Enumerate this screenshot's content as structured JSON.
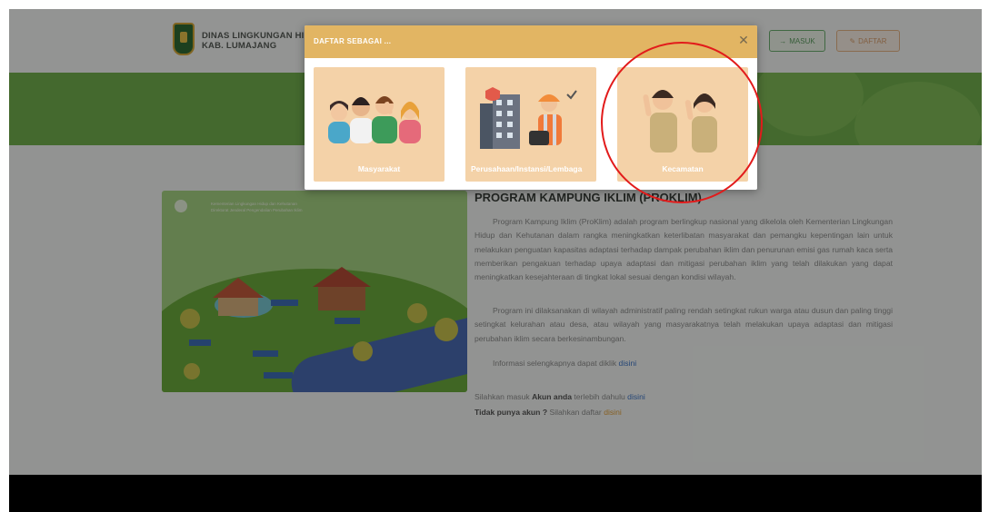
{
  "header": {
    "brand_line1": "DINAS LINGKUNGAN HI",
    "brand_line2": "KAB. LUMAJANG",
    "login_label": "MASUK",
    "register_label": "DAFTAR"
  },
  "icons": {
    "login_icon": "sign-in-icon",
    "register_icon": "edit-icon",
    "close_icon": "close-icon"
  },
  "illustration": {
    "title_line1": "Kementerian Lingkungan Hidup dan Kehutanan",
    "title_line2": "Direktorat Jenderal Pengendalian Perubahan Iklim"
  },
  "article": {
    "title": "PROGRAM KAMPUNG IKLIM (PROKLIM)",
    "paragraph1": "Program Kampung Iklim (ProKlim) adalah program berlingkup nasional yang dikelola oleh Kementerian Lingkungan Hidup dan Kehutanan dalam rangka meningkatkan keterlibatan masyarakat dan pemangku kepentingan lain untuk melakukan penguatan kapasitas adaptasi terhadap dampak perubahan iklim dan penurunan emisi gas rumah kaca serta memberikan pengakuan terhadap upaya adaptasi dan mitigasi perubahan iklim yang telah dilakukan yang dapat meningkatkan kesejahteraan di tingkat lokal sesuai dengan kondisi wilayah.",
    "paragraph2": "Program ini dilaksanakan di wilayah administratif paling rendah setingkat rukun warga atau dusun dan paling tinggi setingkat kelurahan atau desa, atau wilayah yang masyarakatnya telah melakukan upaya adaptasi dan mitigasi perubahan iklim secara berkesinambungan.",
    "info_text": "Informasi selengkapnya dapat diklik",
    "info_link": "disini",
    "login_prefix": "Silahkan masuk",
    "login_bold": "Akun anda",
    "login_middle": "terlebih dahulu",
    "login_link": "disini",
    "register_bold": "Tidak punya akun ?",
    "register_middle": "Silahkan daftar",
    "register_link": "disini"
  },
  "modal": {
    "title": "DAFTAR SEBAGAI ...",
    "options": [
      {
        "label": "Masyarakat"
      },
      {
        "label": "Perusahaan/Instansi/Lembaga"
      },
      {
        "label": "Kecamatan"
      }
    ]
  },
  "colors": {
    "banner": "#72b04d",
    "modal_header": "#e2b563",
    "card": "#f4d2a8",
    "annotation": "#e21b1b"
  }
}
